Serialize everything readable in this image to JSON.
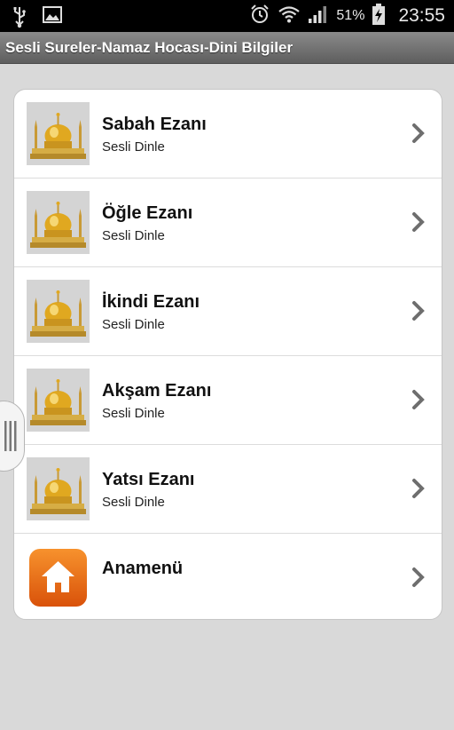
{
  "status_bar": {
    "battery_percent": "51%",
    "time": "23:55"
  },
  "title_bar": {
    "title": "Sesli Sureler-Namaz Hocası-Dini Bilgiler"
  },
  "list": {
    "items": [
      {
        "title": "Sabah Ezanı",
        "subtitle": "Sesli Dinle",
        "icon": "mosque-icon"
      },
      {
        "title": "Öğle Ezanı",
        "subtitle": "Sesli Dinle",
        "icon": "mosque-icon"
      },
      {
        "title": "İkindi Ezanı",
        "subtitle": "Sesli Dinle",
        "icon": "mosque-icon"
      },
      {
        "title": "Akşam Ezanı",
        "subtitle": "Sesli Dinle",
        "icon": "mosque-icon"
      },
      {
        "title": "Yatsı Ezanı",
        "subtitle": "Sesli Dinle",
        "icon": "mosque-icon"
      },
      {
        "title": "Anamenü",
        "subtitle": "",
        "icon": "home-icon"
      }
    ]
  },
  "colors": {
    "background": "#d9d9d9",
    "home_icon": "#e8640f",
    "chevron": "#6e6e6e"
  }
}
